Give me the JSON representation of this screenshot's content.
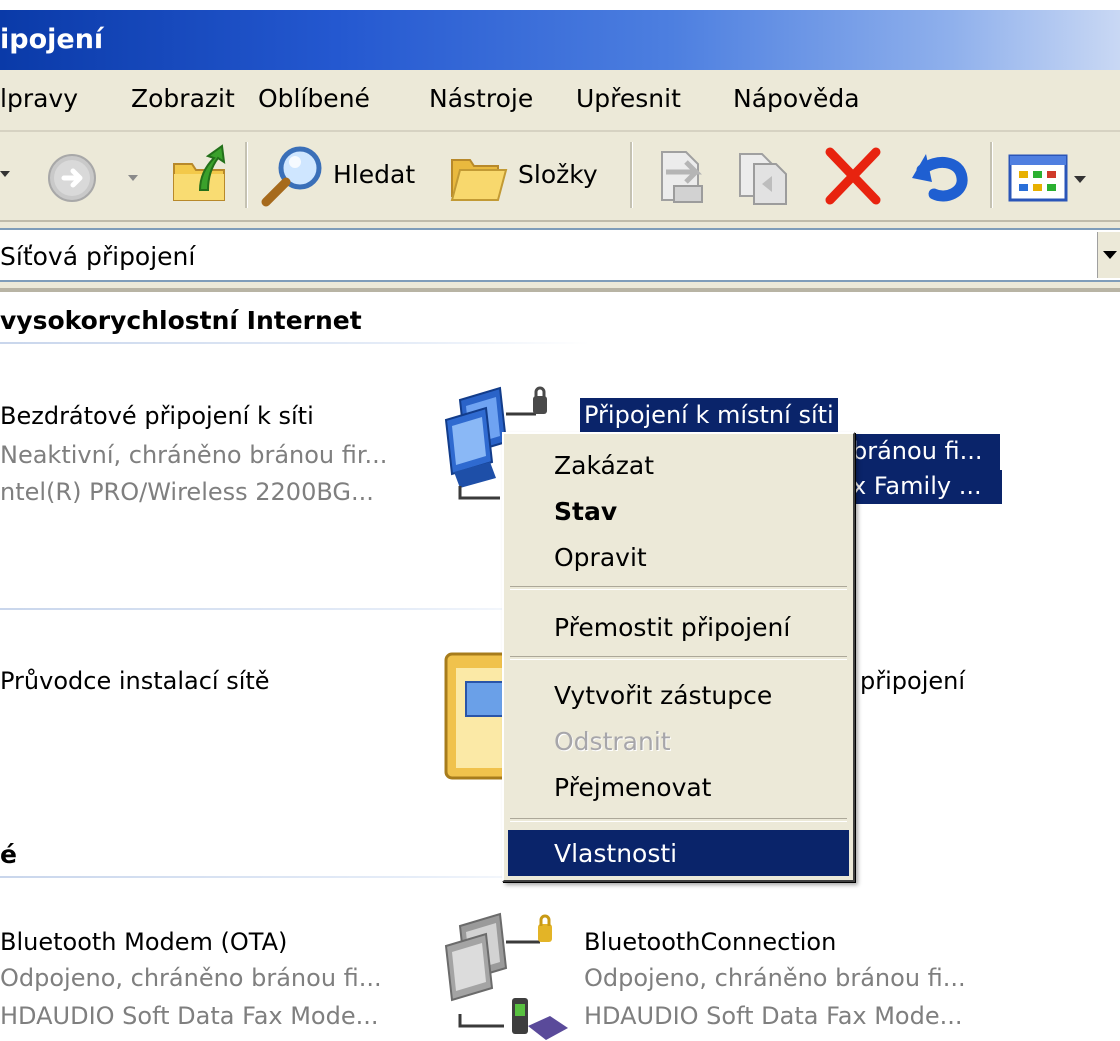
{
  "window": {
    "title": "ipojení"
  },
  "menu": {
    "items": [
      "lpravy",
      "Zobrazit",
      "Oblíbené",
      "Nástroje",
      "Upřesnit",
      "Nápověda"
    ]
  },
  "toolbar": {
    "search_label": "Hledat",
    "folders_label": "Složky"
  },
  "address": {
    "value": "Síťová připojení"
  },
  "groups": {
    "high_speed": {
      "header": "vysokorychlostní Internet"
    },
    "wizard": {},
    "other": {
      "header": "é"
    }
  },
  "items": {
    "wireless": {
      "name": "Bezdrátové připojení k síti",
      "status": "Neaktivní, chráněno bránou fir...",
      "device": "ntel(R) PRO/Wireless 2200BG..."
    },
    "local": {
      "name": "Připojení k místní síti",
      "status_tail": "bránou fi...",
      "device_tail": "x Family ..."
    },
    "wizard_setup": {
      "name": "Průvodce instalací sítě"
    },
    "wizard_new_tail": {
      "name": "připojení"
    },
    "bt_modem": {
      "name": "Bluetooth Modem (OTA)",
      "status": "Odpojeno, chráněno bránou fi...",
      "device": "HDAUDIO Soft Data Fax Mode..."
    },
    "bt_connection": {
      "name": "BluetoothConnection",
      "status": "Odpojeno, chráněno bránou fi...",
      "device": "HDAUDIO Soft Data Fax Mode..."
    }
  },
  "context_menu": {
    "disable": "Zakázat",
    "status": "Stav",
    "repair": "Opravit",
    "bridge": "Přemostit připojení",
    "shortcut": "Vytvořit zástupce",
    "delete": "Odstranit",
    "rename": "Přejmenovat",
    "properties": "Vlastnosti"
  },
  "colors": {
    "selection": "#0a246a",
    "menu_bg": "#ece9d8",
    "title_gradient_start": "#0a3aa8",
    "delete_icon": "#e8230f",
    "undo_icon": "#1f5fd1"
  }
}
